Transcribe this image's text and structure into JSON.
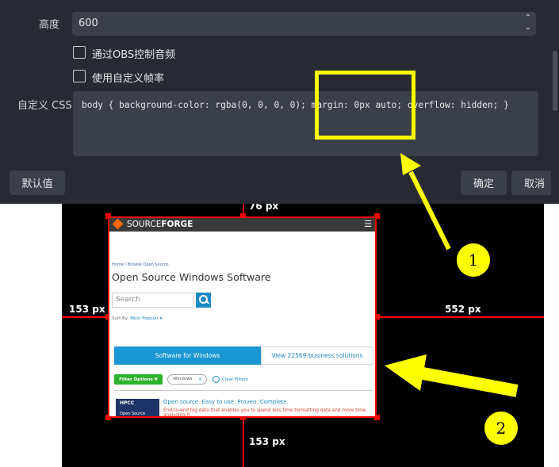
{
  "dialog": {
    "height_label": "高度",
    "height_value": "600",
    "spin_up": "⌃",
    "spin_down": "⌄",
    "checkbox_obs_audio": "通过OBS控制音频",
    "checkbox_custom_fps": "使用自定义帧率",
    "css_label": "自定义 CSS",
    "css_value": "body { background-color: rgba(0, 0, 0, 0); margin: 0px auto; overflow: hidden; }",
    "defaults_button": "默认值",
    "ok_button": "确定",
    "cancel_button": "取消"
  },
  "preview": {
    "top_margin": "76 px",
    "left_margin": "153 px",
    "right_margin": "552 px",
    "bottom_margin": "153 px"
  },
  "sourceforge": {
    "brand_light": "SOURCE",
    "brand_bold": "FORGE",
    "menu_glyph": "☰",
    "breadcrumb": "Home / Browse Open Source",
    "title": "Open Source Windows Software",
    "search_placeholder": "Search",
    "sort_label": "Sort By:",
    "sort_value": "Most Popular ▾",
    "tab_active": "Software for Windows",
    "tab_other": "View 22569 business solutions",
    "filter_button": "Filter Options ▼",
    "chip_label": "Windows",
    "chip_remove": "×",
    "clear_filters": "Clear Filters",
    "result_thumb_title": "HPCC",
    "result_thumb_sub": "Open Source",
    "result_title": "Open source. Easy to use. Proven. Complete.",
    "result_desc": "End-to-end big data that enables you to spend less time formatting data and more time analyzing it"
  },
  "annotations": {
    "marker_1": "1",
    "marker_2": "2",
    "highlight_color": "#ffff00"
  },
  "colors": {
    "dialog_bg": "#272a33",
    "field_bg": "#3b3f4a",
    "guide_red": "#ff0000",
    "sf_blue": "#1a97d2",
    "sf_green": "#2db22d"
  }
}
